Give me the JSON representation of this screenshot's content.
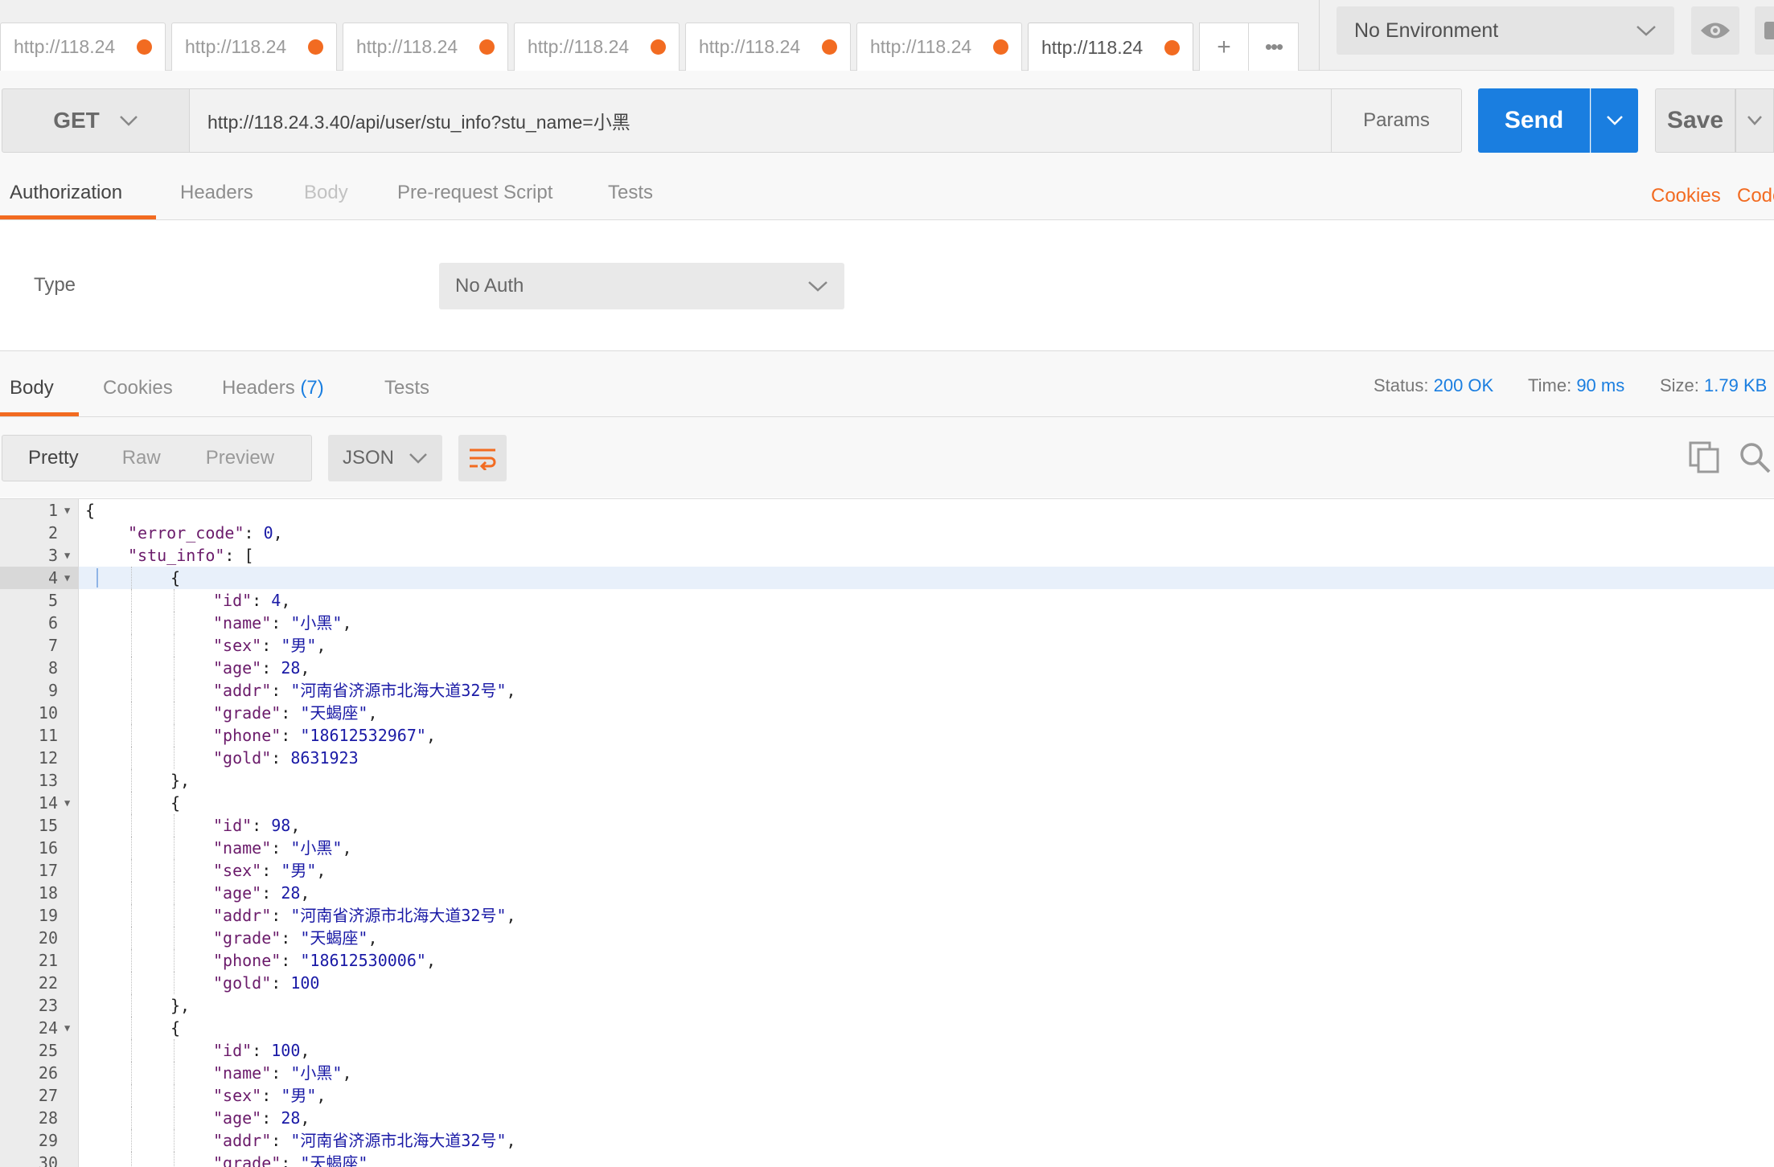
{
  "tabs": {
    "items": [
      {
        "label": "http://118.24"
      },
      {
        "label": "http://118.24"
      },
      {
        "label": "http://118.24"
      },
      {
        "label": "http://118.24"
      },
      {
        "label": "http://118.24"
      },
      {
        "label": "http://118.24"
      },
      {
        "label": "http://118.24"
      }
    ],
    "add_label": "+",
    "more_label": "•••"
  },
  "environment": {
    "selected": "No Environment"
  },
  "request": {
    "method": "GET",
    "url": "http://118.24.3.40/api/user/stu_info?stu_name=小黑",
    "params_label": "Params",
    "send_label": "Send",
    "save_label": "Save"
  },
  "request_tabs": {
    "authorization": "Authorization",
    "headers": "Headers",
    "body": "Body",
    "prerequest": "Pre-request Script",
    "tests": "Tests",
    "cookies_link": "Cookies",
    "code_link": "Code"
  },
  "auth": {
    "type_label": "Type",
    "selected": "No Auth"
  },
  "response_tabs": {
    "body": "Body",
    "cookies": "Cookies",
    "headers": "Headers",
    "headers_count": "(7)",
    "tests": "Tests"
  },
  "response_meta": {
    "status_label": "Status:",
    "status_value": "200 OK",
    "time_label": "Time:",
    "time_value": "90 ms",
    "size_label": "Size:",
    "size_value": "1.79 KB"
  },
  "response_toolbar": {
    "pretty": "Pretty",
    "raw": "Raw",
    "preview": "Preview",
    "format": "JSON"
  },
  "code_lines": [
    {
      "n": "1",
      "fold": true,
      "indent": 0,
      "parts": [
        [
          "p",
          "{"
        ]
      ]
    },
    {
      "n": "2",
      "indent": 1,
      "parts": [
        [
          "k",
          "\"error_code\""
        ],
        [
          "p",
          ": "
        ],
        [
          "n",
          "0"
        ],
        [
          "p",
          ","
        ]
      ]
    },
    {
      "n": "3",
      "fold": true,
      "indent": 1,
      "parts": [
        [
          "k",
          "\"stu_info\""
        ],
        [
          "p",
          ": ["
        ]
      ]
    },
    {
      "n": "4",
      "fold": true,
      "active": true,
      "indent": 2,
      "parts": [
        [
          "p",
          "{"
        ]
      ]
    },
    {
      "n": "5",
      "indent": 3,
      "parts": [
        [
          "k",
          "\"id\""
        ],
        [
          "p",
          ": "
        ],
        [
          "n",
          "4"
        ],
        [
          "p",
          ","
        ]
      ]
    },
    {
      "n": "6",
      "indent": 3,
      "parts": [
        [
          "k",
          "\"name\""
        ],
        [
          "p",
          ": "
        ],
        [
          "s",
          "\"小黑\""
        ],
        [
          "p",
          ","
        ]
      ]
    },
    {
      "n": "7",
      "indent": 3,
      "parts": [
        [
          "k",
          "\"sex\""
        ],
        [
          "p",
          ": "
        ],
        [
          "s",
          "\"男\""
        ],
        [
          "p",
          ","
        ]
      ]
    },
    {
      "n": "8",
      "indent": 3,
      "parts": [
        [
          "k",
          "\"age\""
        ],
        [
          "p",
          ": "
        ],
        [
          "n",
          "28"
        ],
        [
          "p",
          ","
        ]
      ]
    },
    {
      "n": "9",
      "indent": 3,
      "parts": [
        [
          "k",
          "\"addr\""
        ],
        [
          "p",
          ": "
        ],
        [
          "s",
          "\"河南省济源市北海大道32号\""
        ],
        [
          "p",
          ","
        ]
      ]
    },
    {
      "n": "10",
      "indent": 3,
      "parts": [
        [
          "k",
          "\"grade\""
        ],
        [
          "p",
          ": "
        ],
        [
          "s",
          "\"天蝎座\""
        ],
        [
          "p",
          ","
        ]
      ]
    },
    {
      "n": "11",
      "indent": 3,
      "parts": [
        [
          "k",
          "\"phone\""
        ],
        [
          "p",
          ": "
        ],
        [
          "s",
          "\"18612532967\""
        ],
        [
          "p",
          ","
        ]
      ]
    },
    {
      "n": "12",
      "indent": 3,
      "parts": [
        [
          "k",
          "\"gold\""
        ],
        [
          "p",
          ": "
        ],
        [
          "n",
          "8631923"
        ]
      ]
    },
    {
      "n": "13",
      "indent": 2,
      "parts": [
        [
          "p",
          "},"
        ]
      ]
    },
    {
      "n": "14",
      "fold": true,
      "indent": 2,
      "parts": [
        [
          "p",
          "{"
        ]
      ]
    },
    {
      "n": "15",
      "indent": 3,
      "parts": [
        [
          "k",
          "\"id\""
        ],
        [
          "p",
          ": "
        ],
        [
          "n",
          "98"
        ],
        [
          "p",
          ","
        ]
      ]
    },
    {
      "n": "16",
      "indent": 3,
      "parts": [
        [
          "k",
          "\"name\""
        ],
        [
          "p",
          ": "
        ],
        [
          "s",
          "\"小黑\""
        ],
        [
          "p",
          ","
        ]
      ]
    },
    {
      "n": "17",
      "indent": 3,
      "parts": [
        [
          "k",
          "\"sex\""
        ],
        [
          "p",
          ": "
        ],
        [
          "s",
          "\"男\""
        ],
        [
          "p",
          ","
        ]
      ]
    },
    {
      "n": "18",
      "indent": 3,
      "parts": [
        [
          "k",
          "\"age\""
        ],
        [
          "p",
          ": "
        ],
        [
          "n",
          "28"
        ],
        [
          "p",
          ","
        ]
      ]
    },
    {
      "n": "19",
      "indent": 3,
      "parts": [
        [
          "k",
          "\"addr\""
        ],
        [
          "p",
          ": "
        ],
        [
          "s",
          "\"河南省济源市北海大道32号\""
        ],
        [
          "p",
          ","
        ]
      ]
    },
    {
      "n": "20",
      "indent": 3,
      "parts": [
        [
          "k",
          "\"grade\""
        ],
        [
          "p",
          ": "
        ],
        [
          "s",
          "\"天蝎座\""
        ],
        [
          "p",
          ","
        ]
      ]
    },
    {
      "n": "21",
      "indent": 3,
      "parts": [
        [
          "k",
          "\"phone\""
        ],
        [
          "p",
          ": "
        ],
        [
          "s",
          "\"18612530006\""
        ],
        [
          "p",
          ","
        ]
      ]
    },
    {
      "n": "22",
      "indent": 3,
      "parts": [
        [
          "k",
          "\"gold\""
        ],
        [
          "p",
          ": "
        ],
        [
          "n",
          "100"
        ]
      ]
    },
    {
      "n": "23",
      "indent": 2,
      "parts": [
        [
          "p",
          "},"
        ]
      ]
    },
    {
      "n": "24",
      "fold": true,
      "indent": 2,
      "parts": [
        [
          "p",
          "{"
        ]
      ]
    },
    {
      "n": "25",
      "indent": 3,
      "parts": [
        [
          "k",
          "\"id\""
        ],
        [
          "p",
          ": "
        ],
        [
          "n",
          "100"
        ],
        [
          "p",
          ","
        ]
      ]
    },
    {
      "n": "26",
      "indent": 3,
      "parts": [
        [
          "k",
          "\"name\""
        ],
        [
          "p",
          ": "
        ],
        [
          "s",
          "\"小黑\""
        ],
        [
          "p",
          ","
        ]
      ]
    },
    {
      "n": "27",
      "indent": 3,
      "parts": [
        [
          "k",
          "\"sex\""
        ],
        [
          "p",
          ": "
        ],
        [
          "s",
          "\"男\""
        ],
        [
          "p",
          ","
        ]
      ]
    },
    {
      "n": "28",
      "indent": 3,
      "parts": [
        [
          "k",
          "\"age\""
        ],
        [
          "p",
          ": "
        ],
        [
          "n",
          "28"
        ],
        [
          "p",
          ","
        ]
      ]
    },
    {
      "n": "29",
      "indent": 3,
      "parts": [
        [
          "k",
          "\"addr\""
        ],
        [
          "p",
          ": "
        ],
        [
          "s",
          "\"河南省济源市北海大道32号\""
        ],
        [
          "p",
          ","
        ]
      ]
    },
    {
      "n": "30",
      "indent": 3,
      "parts": [
        [
          "k",
          "\"grade\""
        ],
        [
          "p",
          ": "
        ],
        [
          "s",
          "\"天蝎座\""
        ]
      ]
    }
  ],
  "colors": {
    "accent_orange": "#f26b21",
    "send_blue": "#1a7ee0",
    "json_key": "#6b1b6b",
    "json_value": "#1a1aa6"
  }
}
